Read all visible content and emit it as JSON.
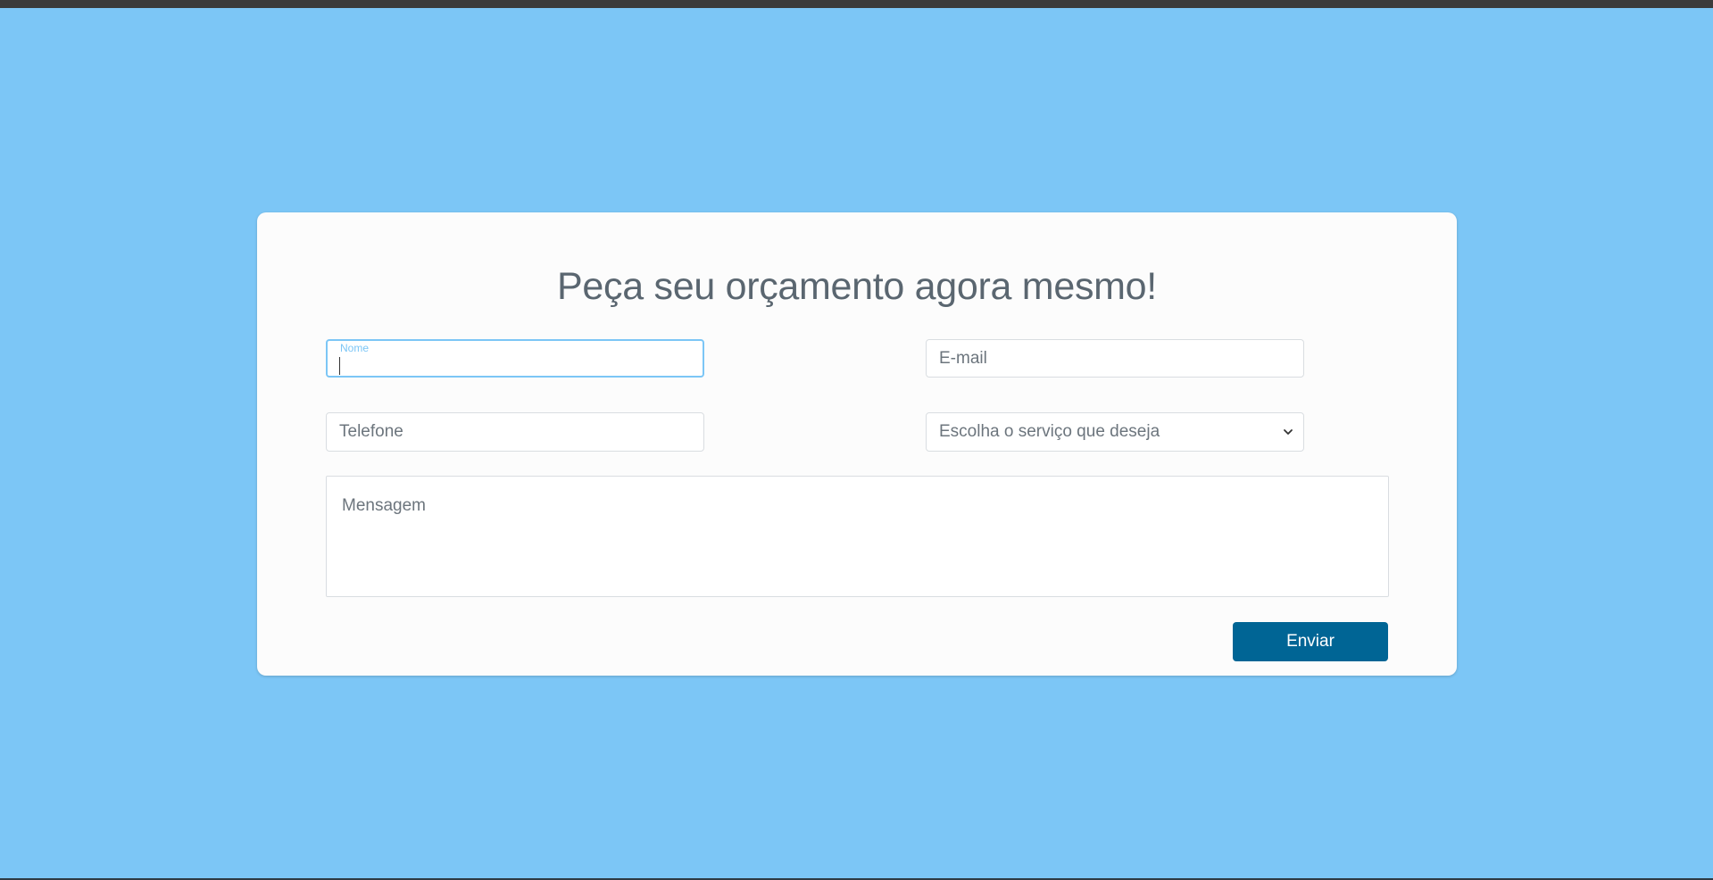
{
  "form": {
    "title": "Peça seu orçamento agora mesmo!",
    "name_field": {
      "label": "Nome",
      "value": ""
    },
    "email_field": {
      "placeholder": "E-mail"
    },
    "phone_field": {
      "placeholder": "Telefone"
    },
    "service_select": {
      "selected": "Escolha o serviço que deseja",
      "icon": "chevron-down-icon"
    },
    "message_field": {
      "placeholder": "Mensagem"
    },
    "submit_label": "Enviar"
  },
  "colors": {
    "background": "#7cc6f6",
    "card": "#fcfcfc",
    "accent": "#7cc6f6",
    "button": "#006595",
    "title_text": "#5a6670"
  }
}
